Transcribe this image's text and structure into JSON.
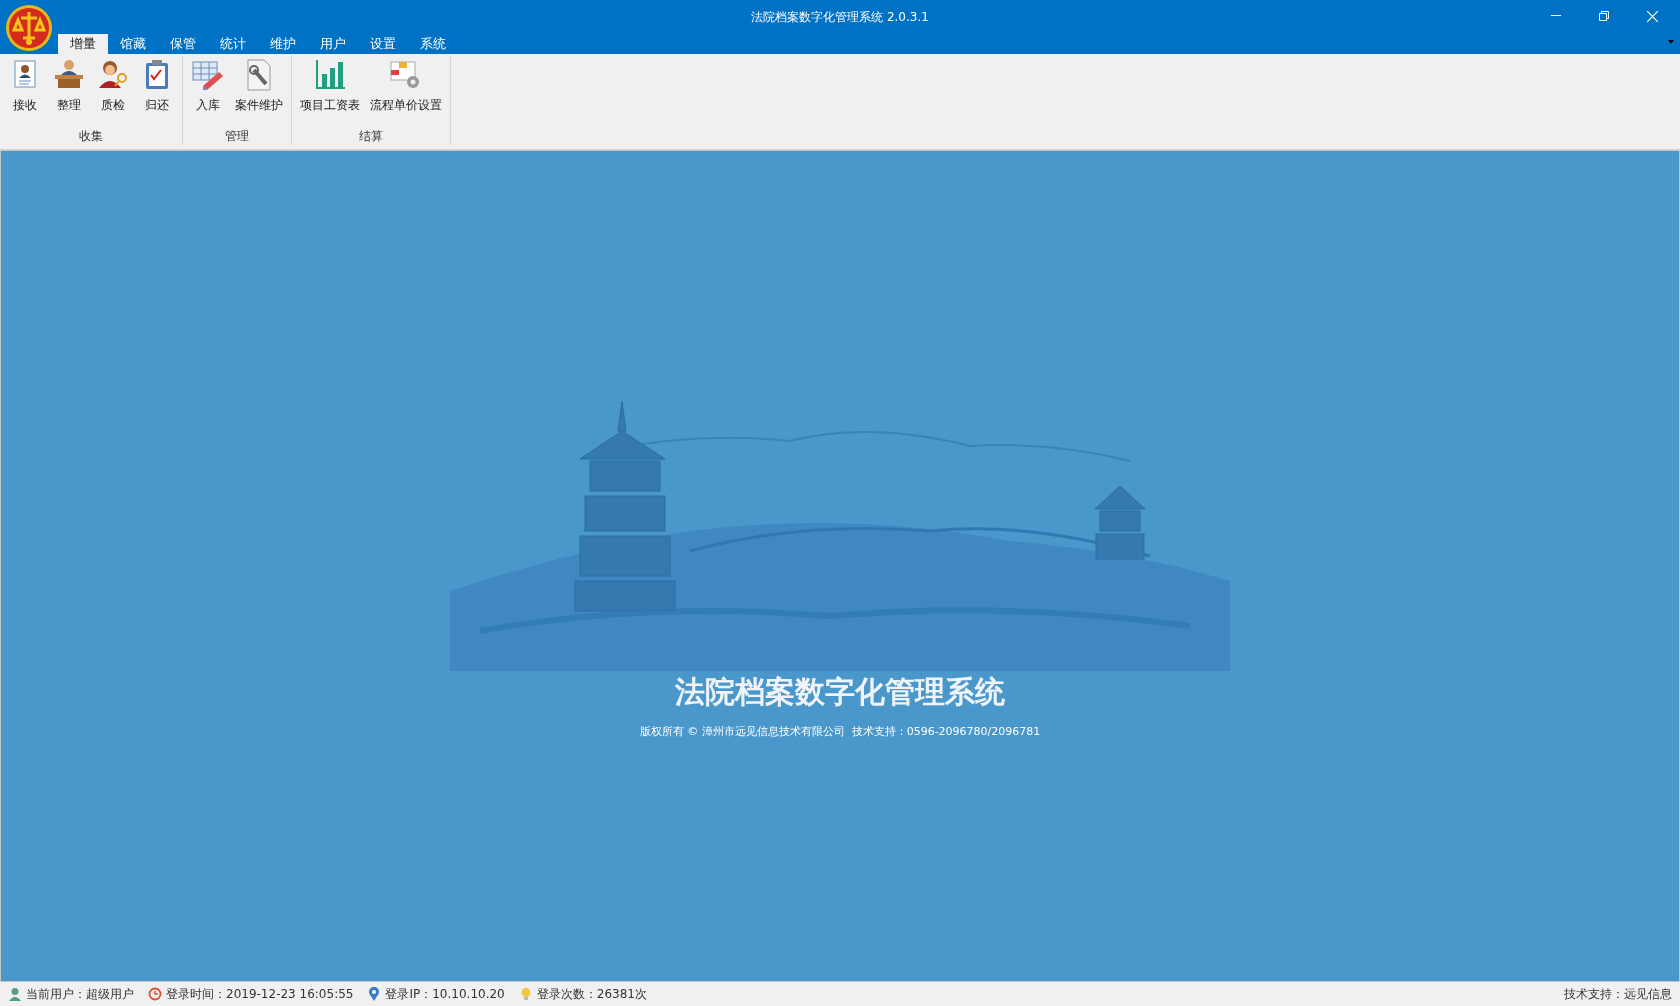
{
  "window": {
    "title": "法院档案数字化管理系统 2.0.3.1"
  },
  "tabs": [
    {
      "label": "增量",
      "selected": true
    },
    {
      "label": "馆藏",
      "selected": false
    },
    {
      "label": "保管",
      "selected": false
    },
    {
      "label": "统计",
      "selected": false
    },
    {
      "label": "维护",
      "selected": false
    },
    {
      "label": "用户",
      "selected": false
    },
    {
      "label": "设置",
      "selected": false
    },
    {
      "label": "系统",
      "selected": false
    }
  ],
  "ribbon_groups": [
    {
      "label": "收集",
      "buttons": [
        {
          "kind": "receive",
          "label": "接收"
        },
        {
          "kind": "organize",
          "label": "整理"
        },
        {
          "kind": "inspect",
          "label": "质检"
        },
        {
          "kind": "return",
          "label": "归还"
        }
      ]
    },
    {
      "label": "管理",
      "buttons": [
        {
          "kind": "storage",
          "label": "入库"
        },
        {
          "kind": "maintain",
          "label": "案件维护"
        }
      ]
    },
    {
      "label": "结算",
      "buttons": [
        {
          "kind": "chart",
          "label": "项目工资表"
        },
        {
          "kind": "settings",
          "label": "流程单价设置"
        }
      ]
    }
  ],
  "splash": {
    "title": "法院档案数字化管理系统",
    "copyright": "版权所有 © 漳州市远见信息技术有限公司  技术支持：0596-2096780/2096781"
  },
  "status_bar": {
    "items": [
      {
        "kind": "user",
        "text": "当前用户：超级用户"
      },
      {
        "kind": "clock",
        "text": "登录时间：2019-12-23 16:05:55"
      },
      {
        "kind": "location",
        "text": "登录IP：10.10.10.20"
      },
      {
        "kind": "bulb",
        "text": "登录次数：26381次"
      }
    ],
    "right": "技术支持：远见信息"
  }
}
